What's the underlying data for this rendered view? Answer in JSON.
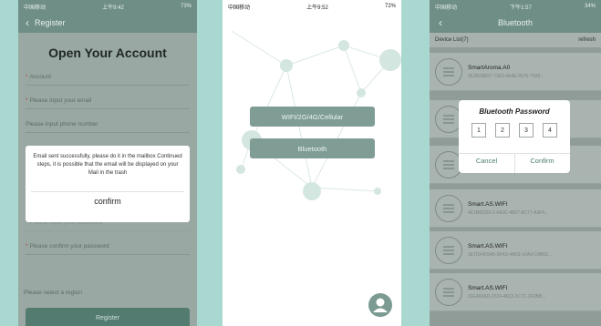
{
  "phone1": {
    "status": {
      "carrier": "中国移动",
      "time": "上午9:42",
      "battery": "73%"
    },
    "nav": {
      "back_icon": "chevron-left-icon",
      "title": "Register"
    },
    "heading": "Open Your Account",
    "fields": [
      "Account",
      "Please input your email",
      "Please input phone number"
    ],
    "field_hidden": "Please input your password",
    "field_confirm": "Please confirm your password",
    "dialog": {
      "message": "Email sent successfully, please do it in the mailbox Continued steps, it is possible that the email will be displayed on your Mail in the trash",
      "confirm": "confirm"
    },
    "region": "Please select a region",
    "register": "Register",
    "colors": {
      "accent": "#537b70",
      "required": "#b0473c"
    }
  },
  "phone2": {
    "status": {
      "carrier": "中国移动",
      "time": "上午9:52",
      "battery": "72%"
    },
    "buttons": [
      "WIFI/2G/4G/Cellular",
      "Bluetooth"
    ],
    "avatar_icon": "user-icon",
    "colors": {
      "button": "#7f9d95"
    }
  },
  "phone3": {
    "status": {
      "carrier": "中国移动",
      "time": "下午1:57",
      "battery": "34%"
    },
    "nav": {
      "back_icon": "chevron-left-icon",
      "title": "Bluetooth"
    },
    "list_label": "Device List(7)",
    "refresh": "refresh",
    "devices": [
      {
        "name": "SmartAroma.A0",
        "id": "0E281BE57-7363-4A4E-9575-75A5..."
      },
      {
        "name": "",
        "id": ""
      },
      {
        "name": "",
        "id": ""
      },
      {
        "name": "Smart.AS.WIFI",
        "id": "4E1B6DD9-2-A60C-4B07-8C77-A3F4..."
      },
      {
        "name": "Smart.AS.WIFI",
        "id": "3E7DF4D945-8F4D-4B03-1FA9-C4B63..."
      },
      {
        "name": "Smart.AS.WIFI",
        "id": "31E493AD-2724-4563-3C7C-3F0BB..."
      }
    ],
    "dialog": {
      "title": "Bluetooth Password",
      "pin": [
        "1",
        "2",
        "3",
        "4"
      ],
      "cancel": "Cancel",
      "confirm": "Confirm"
    }
  }
}
